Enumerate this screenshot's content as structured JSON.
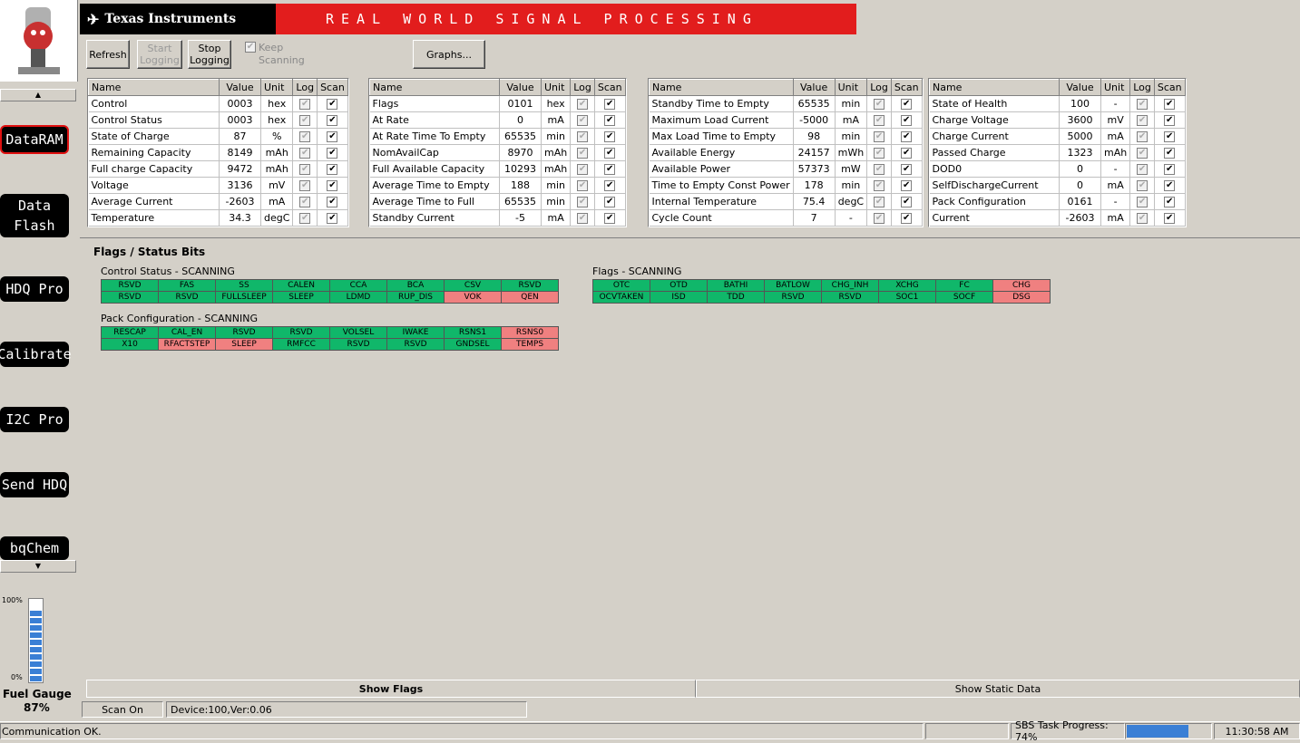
{
  "banner": {
    "ti": "Texas Instruments",
    "tagline": "REAL WORLD SIGNAL PROCESSING"
  },
  "toolbar": {
    "refresh": "Refresh",
    "start_logging": "Start\nLogging",
    "stop_logging": "Stop\nLogging",
    "keep_scanning": "Keep\nScanning",
    "graphs": "Graphs..."
  },
  "nav": [
    "DataRAM",
    "Data\nFlash",
    "HDQ Pro",
    "Calibrate",
    "I2C Pro",
    "Send HDQ",
    "bqChem"
  ],
  "fuel": {
    "top": "100%",
    "bottom": "0%",
    "label": "Fuel Gauge",
    "percent": "87%",
    "level": 0.87
  },
  "columns": [
    "Name",
    "Value",
    "Unit",
    "Log",
    "Scan"
  ],
  "tables": [
    [
      [
        "Control",
        "0003",
        "hex"
      ],
      [
        "Control Status",
        "0003",
        "hex"
      ],
      [
        "State of Charge",
        "87",
        "%"
      ],
      [
        "Remaining Capacity",
        "8149",
        "mAh"
      ],
      [
        "Full charge Capacity",
        "9472",
        "mAh"
      ],
      [
        "Voltage",
        "3136",
        "mV"
      ],
      [
        "Average Current",
        "-2603",
        "mA"
      ],
      [
        "Temperature",
        "34.3",
        "degC"
      ]
    ],
    [
      [
        "Flags",
        "0101",
        "hex"
      ],
      [
        "At Rate",
        "0",
        "mA"
      ],
      [
        "At Rate Time To Empty",
        "65535",
        "min"
      ],
      [
        "NomAvailCap",
        "8970",
        "mAh"
      ],
      [
        "Full Available Capacity",
        "10293",
        "mAh"
      ],
      [
        "Average Time to Empty",
        "188",
        "min"
      ],
      [
        "Average Time to Full",
        "65535",
        "min"
      ],
      [
        "Standby Current",
        "-5",
        "mA"
      ]
    ],
    [
      [
        "Standby Time to Empty",
        "65535",
        "min"
      ],
      [
        "Maximum Load Current",
        "-5000",
        "mA"
      ],
      [
        "Max Load Time to Empty",
        "98",
        "min"
      ],
      [
        "Available Energy",
        "24157",
        "mWh"
      ],
      [
        "Available Power",
        "57373",
        "mW"
      ],
      [
        "Time to Empty Const Power",
        "178",
        "min"
      ],
      [
        "Internal Temperature",
        "75.4",
        "degC"
      ],
      [
        "Cycle Count",
        "7",
        "-"
      ]
    ],
    [
      [
        "State of Health",
        "100",
        "-"
      ],
      [
        "Charge Voltage",
        "3600",
        "mV"
      ],
      [
        "Charge Current",
        "5000",
        "mA"
      ],
      [
        "Passed Charge",
        "1323",
        "mAh"
      ],
      [
        "DOD0",
        "0",
        "-"
      ],
      [
        "SelfDischargeCurrent",
        "0",
        "mA"
      ],
      [
        "Pack Configuration",
        "0161",
        "-"
      ],
      [
        "Current",
        "-2603",
        "mA"
      ]
    ]
  ],
  "flags_title": "Flags / Status Bits",
  "groups": [
    {
      "title": "Control Status - SCANNING",
      "rows": [
        [
          [
            "RSVD",
            1
          ],
          [
            "FAS",
            1
          ],
          [
            "SS",
            1
          ],
          [
            "CALEN",
            1
          ],
          [
            "CCA",
            1
          ],
          [
            "BCA",
            1
          ],
          [
            "CSV",
            1
          ],
          [
            "RSVD",
            1
          ]
        ],
        [
          [
            "RSVD",
            1
          ],
          [
            "RSVD",
            1
          ],
          [
            "FULLSLEEP",
            1
          ],
          [
            "SLEEP",
            1
          ],
          [
            "LDMD",
            1
          ],
          [
            "RUP_DIS",
            1
          ],
          [
            "VOK",
            0
          ],
          [
            "QEN",
            0
          ]
        ]
      ]
    },
    {
      "title": "Pack Configuration - SCANNING",
      "rows": [
        [
          [
            "RESCAP",
            1
          ],
          [
            "CAL_EN",
            1
          ],
          [
            "RSVD",
            1
          ],
          [
            "RSVD",
            1
          ],
          [
            "VOLSEL",
            1
          ],
          [
            "IWAKE",
            1
          ],
          [
            "RSNS1",
            1
          ],
          [
            "RSNS0",
            0
          ]
        ],
        [
          [
            "X10",
            1
          ],
          [
            "RFACTSTEP",
            0
          ],
          [
            "SLEEP",
            0
          ],
          [
            "RMFCC",
            1
          ],
          [
            "RSVD",
            1
          ],
          [
            "RSVD",
            1
          ],
          [
            "GNDSEL",
            1
          ],
          [
            "TEMPS",
            0
          ]
        ]
      ]
    },
    {
      "title": "Flags - SCANNING",
      "rows": [
        [
          [
            "OTC",
            1
          ],
          [
            "OTD",
            1
          ],
          [
            "BATHI",
            1
          ],
          [
            "BATLOW",
            1
          ],
          [
            "CHG_INH",
            1
          ],
          [
            "XCHG",
            1
          ],
          [
            "FC",
            1
          ],
          [
            "CHG",
            0
          ]
        ],
        [
          [
            "OCVTAKEN",
            1
          ],
          [
            "ISD",
            1
          ],
          [
            "TDD",
            1
          ],
          [
            "RSVD",
            1
          ],
          [
            "RSVD",
            1
          ],
          [
            "SOC1",
            1
          ],
          [
            "SOCF",
            1
          ],
          [
            "DSG",
            0
          ]
        ]
      ]
    }
  ],
  "tabs": {
    "show_flags": "Show Flags",
    "show_static": "Show Static Data"
  },
  "status": {
    "scan": "Scan On",
    "device": "Device:100,Ver:0.06",
    "comm": "Communication OK.",
    "task": "SBS Task Progress: 74%",
    "task_level": 0.74,
    "time": "11:30:58 AM"
  },
  "colors": {
    "on": "#10b76a",
    "off": "#f08080",
    "banner_red": "#e21d1d"
  }
}
